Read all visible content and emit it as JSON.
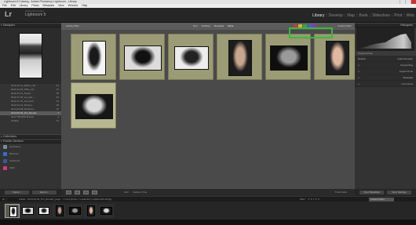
{
  "window": {
    "title": "Lightroom 5 Catalog - Adobe Photoshop Lightroom - Library"
  },
  "menu": [
    "File",
    "Edit",
    "Library",
    "Photo",
    "Metadata",
    "View",
    "Window",
    "Help"
  ],
  "identity": {
    "brand": "Lr",
    "adobe": "Adobe Photoshop",
    "product": "Lightroom 5"
  },
  "modules": [
    "Library",
    "Develop",
    "Map",
    "Book",
    "Slideshow",
    "Print",
    "Web"
  ],
  "module_sep": "|",
  "left_panel": {
    "navigator": "Navigator",
    "folders": [
      {
        "name": "2011-03-14_Wilson_Sa...",
        "count": "21"
      },
      {
        "name": "2011-04-08_PPE_exh...",
        "count": "16"
      },
      {
        "name": "2011-04-11_Studio...",
        "count": "35"
      },
      {
        "name": "2011-07-30_sel_dvd_...",
        "count": "42"
      },
      {
        "name": "2011-07-31_dvd_Ssb...",
        "count": "11"
      },
      {
        "name": "2012-01-13_Boudoi...",
        "count": "28"
      },
      {
        "name": "2014-03-08_Rebecca...",
        "count": "12"
      },
      {
        "name": "2014-05-04_Pro_Boudo...",
        "count": "7"
      },
      {
        "name": "Jans TRUSSS Bowtie",
        "count": "4"
      },
      {
        "name": "2Ndtab",
        "count": "21"
      }
    ],
    "selected_folder_index": 7,
    "collections": "Collections",
    "publish": "Publish Services",
    "publish_items": [
      {
        "label": "Hard Drive",
        "color": "#7c8a99"
      },
      {
        "label": "Behance",
        "color": "#2d6fd6"
      },
      {
        "label": "Facebook",
        "color": "#3b5998"
      },
      {
        "label": "Flickr",
        "color": "#d03b7a"
      }
    ],
    "import_btn": "Import...",
    "export_btn": "Export..."
  },
  "filter_bar": {
    "label": "Library Filter :",
    "tabs": [
      "Text",
      "Attribute",
      "Metadata",
      "None"
    ],
    "active_tab": "None",
    "custom": "Custom Filter",
    "label_colors": [
      "#c43b3b",
      "#c9b735",
      "#3aa14a",
      "#3b68c3",
      "#8b3bb0"
    ]
  },
  "grid": {
    "photos": [
      {
        "bg": "#f4f4f4",
        "fg": "#1a1a1a",
        "w": 30,
        "h": 44
      },
      {
        "bg": "#dcdcdc",
        "fg": "#111",
        "w": 48,
        "h": 32
      },
      {
        "bg": "#ededed",
        "fg": "#222",
        "w": 44,
        "h": 30
      },
      {
        "bg": "#1c1c1c",
        "fg": "#c8a58f",
        "w": 30,
        "h": 46
      },
      {
        "bg": "#0f0f0f",
        "fg": "#9a9a9a",
        "w": 48,
        "h": 32
      },
      {
        "bg": "#1e1e1e",
        "fg": "#e0b8a2",
        "w": 30,
        "h": 44
      },
      {
        "bg": "#161616",
        "fg": "#d9d9d9",
        "w": 48,
        "h": 32
      }
    ],
    "selected_index": 6
  },
  "toolbar": {
    "sort_label": "Sort :",
    "sort_value": "Capture Time",
    "thumbs": "Thumbnails"
  },
  "right_panel": {
    "histogram": "Histogram",
    "original": "Original Photo",
    "quick_develop": "Quick Develop",
    "keywording": "Keywording",
    "keyword_list": "Keyword List",
    "metadata": "Metadata",
    "comments": "Comments",
    "preset": "Default",
    "sync_meta": "Sync Metadata",
    "sync_settings": "Sync Settings"
  },
  "status": {
    "path": "Folder : 2014-05-04_Pro_Boudoir_page · 7 of 21 photos / 1 selected / smittenclick-46.jpg",
    "filter": "Filter :",
    "stars": "★★★★★",
    "filter_select": "Custom Filter"
  },
  "filmstrip": {
    "thumbs": [
      {
        "bg": "#f4f4f4",
        "fg": "#1a1a1a",
        "w": 10,
        "h": 14
      },
      {
        "bg": "#dcdcdc",
        "fg": "#111",
        "w": 15,
        "h": 10
      },
      {
        "bg": "#ededed",
        "fg": "#222",
        "w": 14,
        "h": 10
      },
      {
        "bg": "#1c1c1c",
        "fg": "#c8a58f",
        "w": 10,
        "h": 14
      },
      {
        "bg": "#0f0f0f",
        "fg": "#9a9a9a",
        "w": 15,
        "h": 10
      },
      {
        "bg": "#1e1e1e",
        "fg": "#e0b8a2",
        "w": 10,
        "h": 14
      },
      {
        "bg": "#161616",
        "fg": "#d9d9d9",
        "w": 15,
        "h": 10
      }
    ],
    "selected_index": 0
  }
}
